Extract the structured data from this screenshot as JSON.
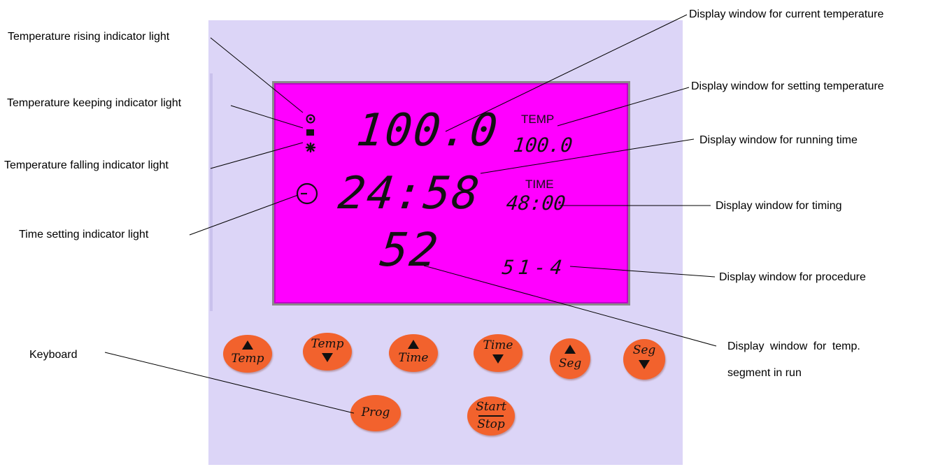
{
  "lcd": {
    "current_temperature": "100.0",
    "temp_label": "TEMP",
    "setting_temperature": "100.0",
    "running_time": "24:58",
    "time_label": "TIME",
    "timing": "48:00",
    "segment_in_run": "52",
    "procedure": "51-4"
  },
  "keys": {
    "temp_up": "Temp",
    "temp_down": "Temp",
    "time_up": "Time",
    "time_down": "Time",
    "seg_up": "Seg",
    "seg_down": "Seg",
    "prog": "Prog",
    "start": "Start",
    "stop": "Stop"
  },
  "callouts": {
    "temperature_rising": "Temperature rising indicator light",
    "temperature_keeping": "Temperature keeping indicator light",
    "temperature_falling": "Temperature falling indicator light",
    "time_setting": "Time setting indicator light",
    "keyboard": "Keyboard",
    "current_temperature": "Display window for current temperature",
    "setting_temperature": "Display window for setting temperature",
    "running_time": "Display window for running time",
    "timing": "Display window for timing",
    "procedure": "Display window for procedure",
    "segment_in_run_line1": "Display window for temp.",
    "segment_in_run_line2": "segment in run"
  },
  "colors": {
    "panel": "#dcd5f7",
    "lcd": "#ff00ff",
    "key": "#f2622d"
  }
}
